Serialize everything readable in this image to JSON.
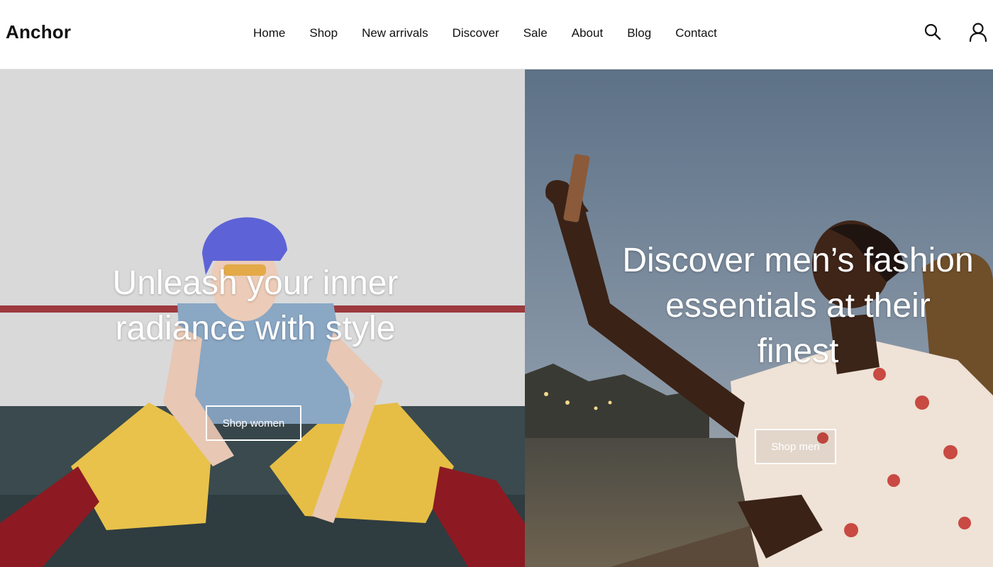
{
  "header": {
    "logo": "Anchor",
    "nav": [
      "Home",
      "Shop",
      "New arrivals",
      "Discover",
      "Sale",
      "About",
      "Blog",
      "Contact"
    ],
    "icons": [
      "search-icon",
      "account-icon"
    ]
  },
  "hero": {
    "left": {
      "title_line1": "Unleash your inner",
      "title_line2": "radiance with style",
      "button": "Shop women"
    },
    "right": {
      "title_line1": "Discover men’s fashion",
      "title_line2": "essentials at their",
      "title_line3": "finest",
      "button": "Shop men"
    }
  },
  "colors": {
    "header_bg": "#ffffff",
    "text": "#111111",
    "hero_text": "#ffffff"
  }
}
